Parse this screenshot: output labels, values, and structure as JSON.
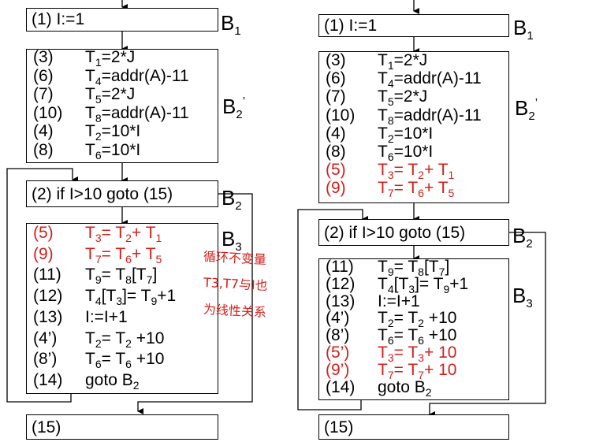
{
  "left": {
    "b1": {
      "num": "(1)",
      "stmt": "I:=1",
      "label": "B",
      "label_sub": "1"
    },
    "b2p": {
      "label": "B",
      "label_sub": "2",
      "label_prime": "’",
      "rows": [
        {
          "num": "(3)",
          "pre": "T",
          "pre_sub": "1",
          "post": "=2*J"
        },
        {
          "num": "(6)",
          "pre": "T",
          "pre_sub": "4",
          "post": "=addr(A)-11"
        },
        {
          "num": "(7)",
          "pre": "T",
          "pre_sub": "5",
          "post": "=2*J"
        },
        {
          "num": "(10)",
          "pre": "T",
          "pre_sub": "8",
          "post": "=addr(A)-11"
        },
        {
          "num": "(4)",
          "pre": "T",
          "pre_sub": "2",
          "post": "=10*I"
        },
        {
          "num": "(8)",
          "pre": "T",
          "pre_sub": "6",
          "post": "=10*I"
        }
      ]
    },
    "b2": {
      "text": "(2) if  I>10 goto (15)",
      "label": "B",
      "label_sub": "2"
    },
    "b3": {
      "label": "B",
      "label_sub": "3",
      "rows": [
        {
          "num": "(5)",
          "html": "T<sub>3</sub>= T<sub>2</sub>+ T<sub>1</sub>",
          "red": true
        },
        {
          "num": "(9)",
          "html": "T<sub>7</sub>= T<sub>6</sub>+ T<sub>5</sub>",
          "red": true
        },
        {
          "num": "(11)",
          "html": "T<sub>9</sub>= T<sub>8</sub>[T<sub>7</sub>]",
          "red": false
        },
        {
          "num": "(12)",
          "html": "T<sub>4</sub>[T<sub>3</sub>]= T<sub>9</sub>+1",
          "red": false
        },
        {
          "num": "(13)",
          "html": "I:=I+1",
          "red": false
        },
        {
          "num": "(4’)",
          "html": "T<sub>2</sub>= T<sub>2</sub> +10",
          "red": false
        },
        {
          "num": "(8’)",
          "html": "T<sub>6</sub>= T<sub>6</sub> +10",
          "red": false
        },
        {
          "num": "(14)",
          "html": "goto B<sub>2</sub>",
          "red": false
        }
      ]
    },
    "b15": {
      "num": "(15)"
    },
    "note": [
      "循环不变量",
      "T3,T7与I也",
      "为线性关系"
    ]
  },
  "right": {
    "b1": {
      "num": "(1)",
      "stmt": "I:=1",
      "label": "B",
      "label_sub": "1"
    },
    "b2p": {
      "label": "B",
      "label_sub": "2",
      "label_prime": "’",
      "rows": [
        {
          "num": "(3)",
          "html": "T<sub>1</sub>=2*J",
          "red": false
        },
        {
          "num": "(6)",
          "html": "T<sub>4</sub>=addr(A)-11",
          "red": false
        },
        {
          "num": "(7)",
          "html": "T<sub>5</sub>=2*J",
          "red": false
        },
        {
          "num": "(10)",
          "html": "T<sub>8</sub>=addr(A)-11",
          "red": false
        },
        {
          "num": "(4)",
          "html": "T<sub>2</sub>=10*I",
          "red": false
        },
        {
          "num": "(8)",
          "html": "T<sub>6</sub>=10*I",
          "red": false
        },
        {
          "num": "(5)",
          "html": "T<sub>3</sub>= T<sub>2</sub>+ T<sub>1</sub>",
          "red": true
        },
        {
          "num": "(9)",
          "html": "T<sub>7</sub>= T<sub>6</sub>+ T<sub>5</sub>",
          "red": true
        }
      ]
    },
    "b2": {
      "text": "(2) if  I>10 goto (15)",
      "label": "B",
      "label_sub": "2"
    },
    "b3": {
      "label": "B",
      "label_sub": "3",
      "rows": [
        {
          "num": "(11)",
          "html": "T<sub>9</sub>= T<sub>8</sub>[T<sub>7</sub>]",
          "red": false
        },
        {
          "num": "(12)",
          "html": "T<sub>4</sub>[T<sub>3</sub>]= T<sub>9</sub>+1",
          "red": false
        },
        {
          "num": "(13)",
          "html": "I:=I+1",
          "red": false
        },
        {
          "num": "(4’)",
          "html": "T<sub>2</sub>= T<sub>2</sub> +10",
          "red": false
        },
        {
          "num": "(8’)",
          "html": "T<sub>6</sub>= T<sub>6</sub> +10",
          "red": false
        },
        {
          "num": "(5’)",
          "html": "T<sub>3</sub>= T<sub>3</sub>+ 10",
          "red": true
        },
        {
          "num": "(9’)",
          "html": "T<sub>7</sub>= T<sub>7</sub>+ 10",
          "red": true
        },
        {
          "num": "(14)",
          "html": "goto B<sub>2</sub>",
          "red": false
        }
      ]
    },
    "b15": {
      "num": "(15)"
    }
  }
}
